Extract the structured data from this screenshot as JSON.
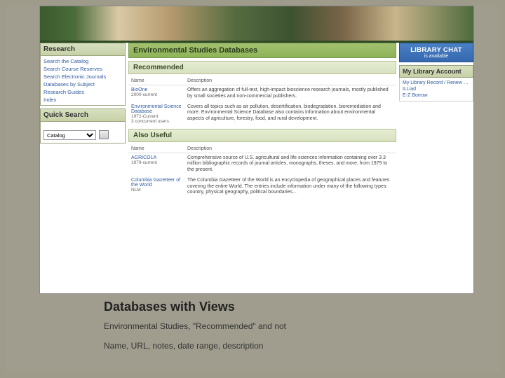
{
  "page_title": "Environmental Studies Databases",
  "sections": {
    "recommended": "Recommended",
    "also_useful": "Also Useful"
  },
  "left": {
    "research_head": "Research",
    "research_items": [
      "Search the Catalog",
      "Search Course Reserves",
      "Search Electronic Journals",
      "Databases by Subject",
      "Research Guides",
      "Index"
    ],
    "quicksearch_head": "Quick Search",
    "quicksearch_option": "Catalog"
  },
  "right": {
    "chat_title": "LIBRARY CHAT",
    "chat_sub": "is available",
    "acct_head": "My Library Account",
    "acct_items": [
      "My Library Record / Renew Books",
      "ILLiad",
      "E-Z Borrow"
    ]
  },
  "table_headers": {
    "name": "Name",
    "desc": "Description"
  },
  "recommended_rows": [
    {
      "name": "BioOne",
      "dates": "2000-current",
      "desc": "Offers an aggregation of full-text, high-impact bioscience research journals, mostly published by small societies and non-commercial publishers."
    },
    {
      "name": "Environmental Science Database",
      "dates": "1972-Current",
      "extra": "3 concurrent users",
      "desc": "Covers all topics such as air pollution, desertification, biodegradation, bioremediation and more. Environmental Science Database also contains information about environmental aspects of agriculture, forestry, food, and rural development."
    }
  ],
  "also_rows": [
    {
      "name": "AGRICOLA",
      "dates": "1979-current",
      "desc": "Comprehensive source of U.S. agricultural and life sciences information containing over 3.3 million bibliographic records of journal articles, monographs, theses, and more, from 1979 to the present."
    },
    {
      "name": "Columbia Gazetteer of the World",
      "dates": "NLM",
      "desc": "The Columbia Gazetteer of the World is an encyclopedia of geographical places and features covering the entire World. The entries include information under many of the following types: country, physical geography, political boundaries..."
    }
  ],
  "caption": {
    "title": "Databases with Views",
    "line1": "Environmental Studies, \"Recommended\" and not",
    "line2": "Name, URL, notes, date range, description"
  }
}
